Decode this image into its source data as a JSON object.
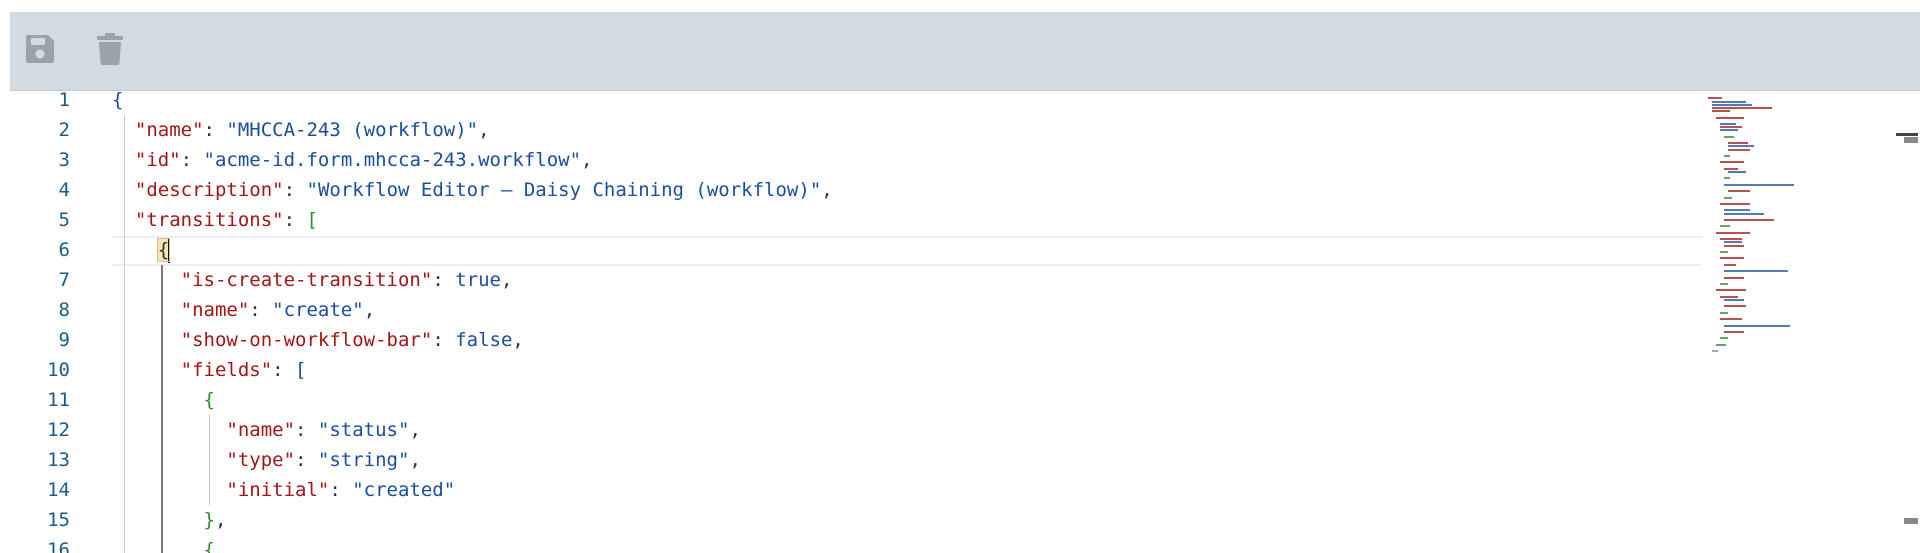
{
  "toolbar": {
    "buttons": [
      {
        "name": "save",
        "icon": "floppy-disk-icon"
      },
      {
        "name": "delete",
        "icon": "trash-icon"
      }
    ]
  },
  "editor": {
    "line_numbers": [
      "1",
      "2",
      "3",
      "4",
      "5",
      "6",
      "7",
      "8",
      "9",
      "10",
      "11",
      "12",
      "13",
      "14",
      "15",
      "16"
    ],
    "json": {
      "name_key": "\"name\"",
      "name_value": "\"MHCCA-243 (workflow)\"",
      "id_key": "\"id\"",
      "id_value": "\"acme-id.form.mhcca-243.workflow\"",
      "description_key": "\"description\"",
      "description_value": "\"Workflow Editor – Daisy Chaining (workflow)\"",
      "transitions_key": "\"transitions\"",
      "is_create_key": "\"is-create-transition\"",
      "is_create_value": "true",
      "t_name_key": "\"name\"",
      "t_name_value": "\"create\"",
      "show_key": "\"show-on-workflow-bar\"",
      "show_value": "false",
      "fields_key": "\"fields\"",
      "f_name_key": "\"name\"",
      "f_name_value": "\"status\"",
      "f_type_key": "\"type\"",
      "f_type_value": "\"string\"",
      "f_initial_key": "\"initial\"",
      "f_initial_value": "\"created\""
    },
    "cursor_line": "6",
    "colors": {
      "key": "#a31515",
      "string": "#1a4da0",
      "bracket": "#2e8b2e",
      "toolbar_bg": "#d3dbe2",
      "line_number": "#1c5a8a"
    }
  }
}
